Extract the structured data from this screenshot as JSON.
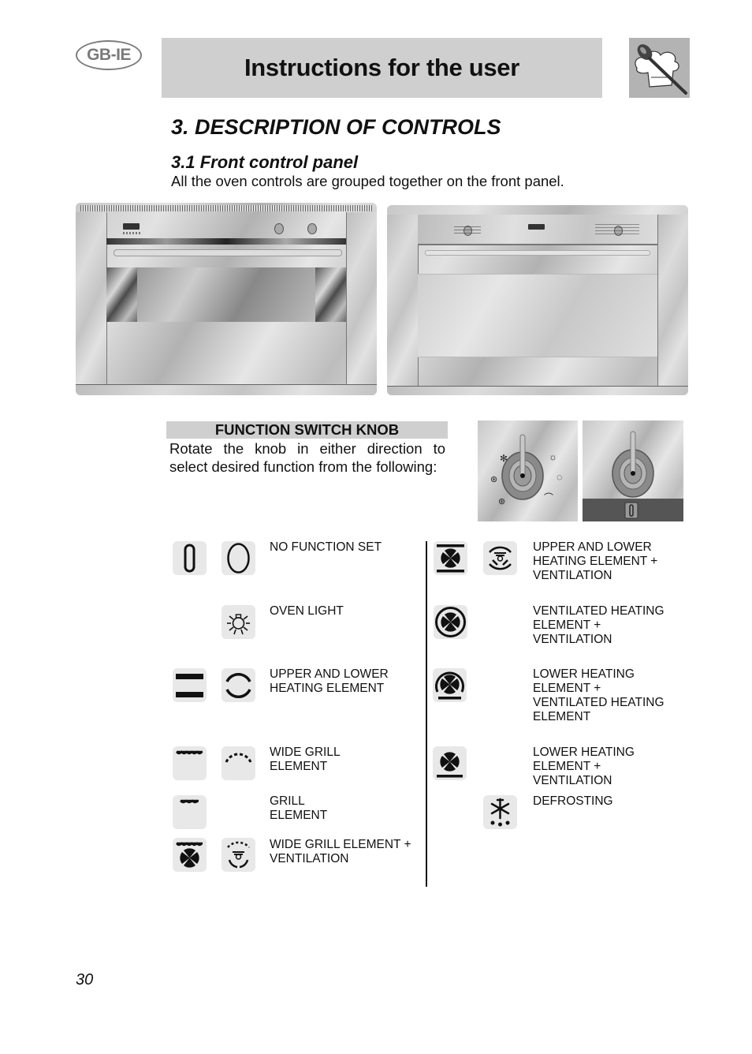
{
  "header": {
    "region_badge": "GB-IE",
    "title": "Instructions for the user",
    "logo_icon": "chef-hat-spoon-icon"
  },
  "section": {
    "heading": "3.  DESCRIPTION OF CONTROLS",
    "subheading": "3.1 Front control panel",
    "intro": "All the oven controls are grouped together on the front panel."
  },
  "ovens": [
    {
      "name": "oven-model-a",
      "description": "Oven front with two knobs and display"
    },
    {
      "name": "oven-model-b",
      "description": "Oven front with timer knob, display and thermostat knob"
    }
  ],
  "function_switch": {
    "title": "FUNCTION SWITCH KNOB",
    "description": "Rotate the knob in either direction to select desired function from the following:"
  },
  "functions_left": [
    {
      "label_lines": [
        "NO FUNCTION SET"
      ],
      "icons": [
        "zero-slot-icon",
        "zero-circle-icon"
      ]
    },
    {
      "label_lines": [
        "OVEN LIGHT"
      ],
      "icons": [
        "",
        "light-bulb-icon"
      ]
    },
    {
      "label_lines": [
        "UPPER AND LOWER",
        "HEATING ELEMENT"
      ],
      "icons": [
        "upper-lower-bars-icon",
        "upper-lower-arcs-icon"
      ]
    },
    {
      "label_lines": [
        "WIDE GRILL",
        "ELEMENT"
      ],
      "icons": [
        "wide-grill-icon",
        "wide-grill-arc-icon"
      ]
    },
    {
      "label_lines": [
        "GRILL",
        "ELEMENT"
      ],
      "icons": [
        "grill-icon",
        ""
      ]
    },
    {
      "label_lines": [
        "WIDE GRILL ELEMENT +",
        "VENTILATION"
      ],
      "icons": [
        "wide-grill-fan-icon",
        "wide-grill-fan-arc-icon"
      ]
    }
  ],
  "functions_right": [
    {
      "label_lines": [
        "UPPER AND LOWER",
        "HEATING ELEMENT +",
        "VENTILATION"
      ],
      "icons": [
        "upper-lower-fan-icon",
        "upper-lower-fan-arc-icon"
      ]
    },
    {
      "label_lines": [
        "VENTILATED HEATING",
        "ELEMENT +",
        "VENTILATION"
      ],
      "icons": [
        "circular-fan-icon",
        ""
      ]
    },
    {
      "label_lines": [
        "LOWER HEATING",
        "ELEMENT +",
        "VENTILATED HEATING",
        "ELEMENT"
      ],
      "icons": [
        "circular-fan-lower-icon",
        ""
      ]
    },
    {
      "label_lines": [
        "LOWER HEATING",
        "ELEMENT +",
        "VENTILATION"
      ],
      "icons": [
        "lower-fan-icon",
        ""
      ]
    },
    {
      "label_lines": [
        "DEFROSTING"
      ],
      "icons": [
        "",
        "defrost-snowflake-icon"
      ]
    }
  ],
  "page_number": "30"
}
